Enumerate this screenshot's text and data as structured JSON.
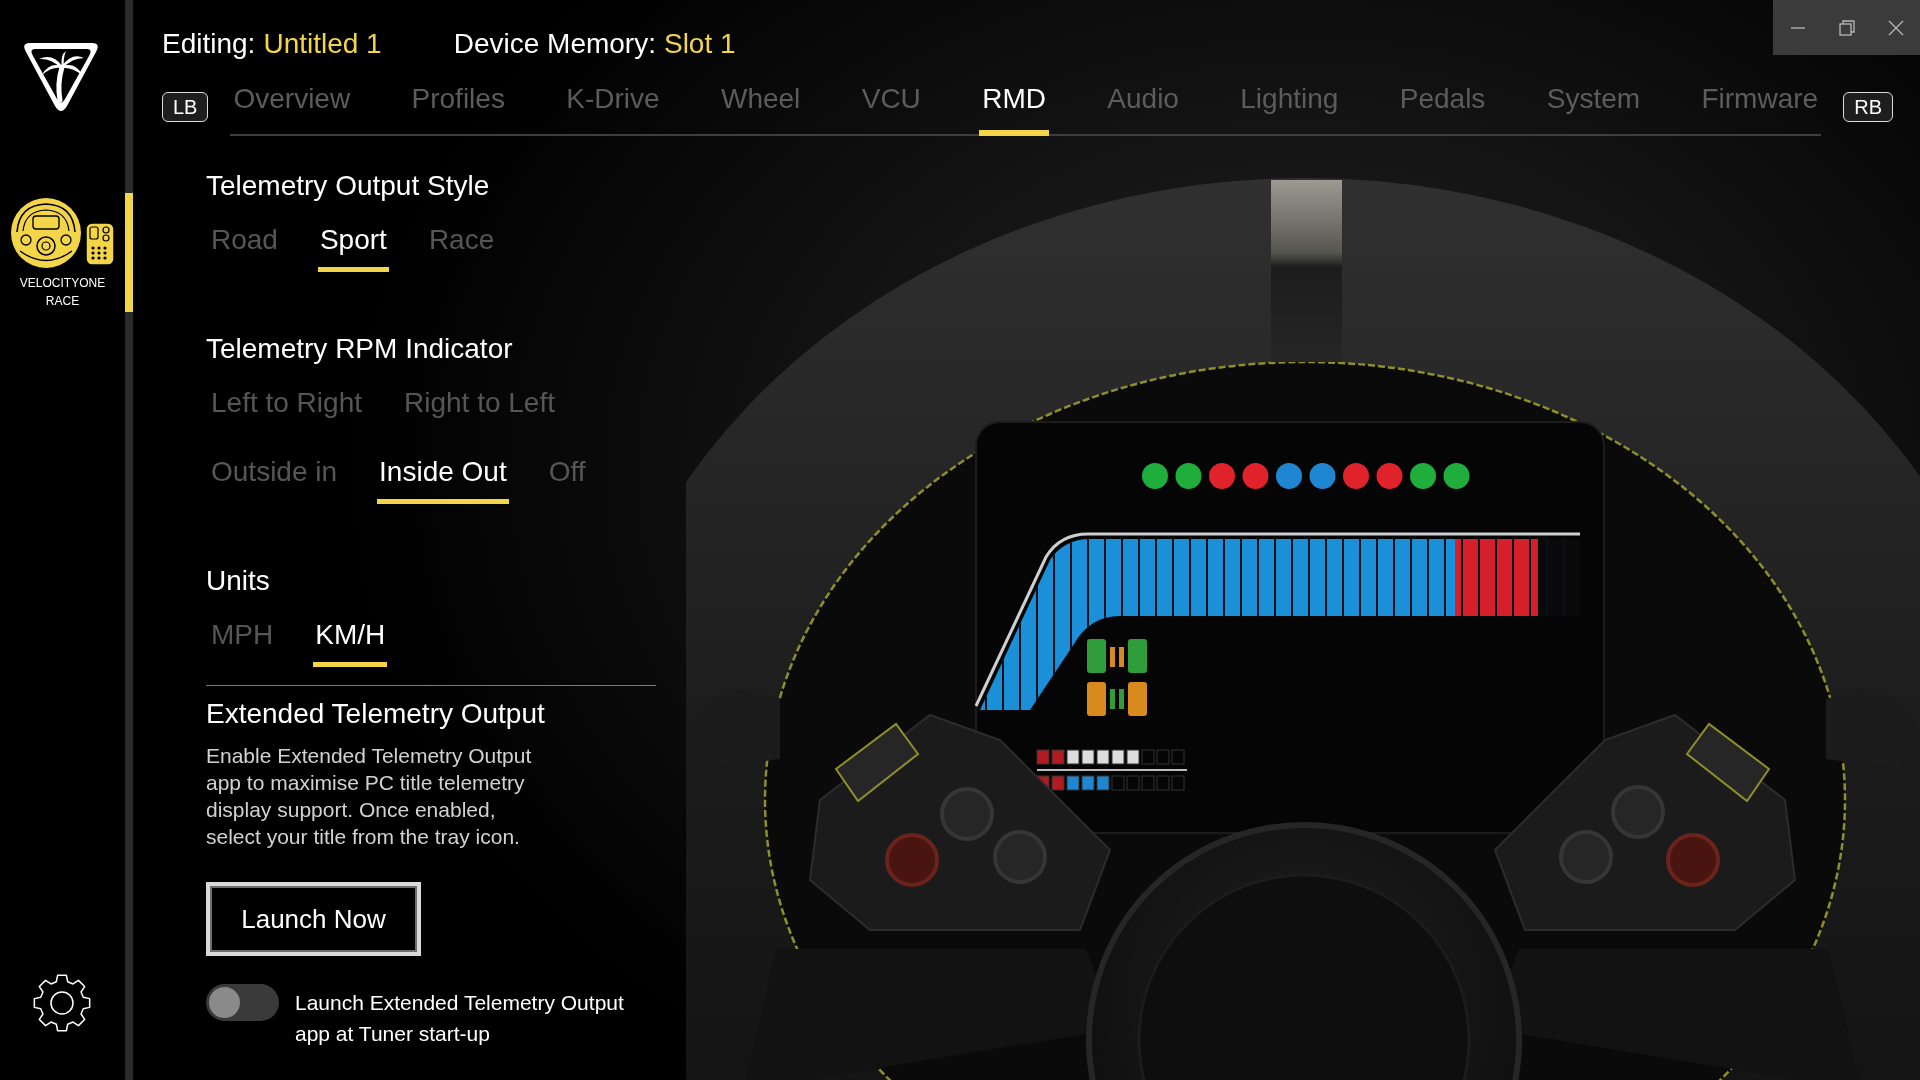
{
  "sidebar": {
    "devices": [
      {
        "name": "VELOCITYONE RACE",
        "selected": true
      }
    ]
  },
  "header": {
    "editing": {
      "label": "Editing:",
      "value": "Untitled 1"
    },
    "memory": {
      "label": "Device Memory:",
      "value": "Slot 1"
    }
  },
  "tabs": {
    "prev_button": "LB",
    "items": [
      {
        "label": "Overview",
        "selected": false
      },
      {
        "label": "Profiles",
        "selected": false
      },
      {
        "label": "K-Drive",
        "selected": false
      },
      {
        "label": "Wheel",
        "selected": false
      },
      {
        "label": "VCU",
        "selected": false
      },
      {
        "label": "RMD",
        "selected": true
      },
      {
        "label": "Audio",
        "selected": false
      },
      {
        "label": "Lighting",
        "selected": false
      },
      {
        "label": "Pedals",
        "selected": false
      },
      {
        "label": "System",
        "selected": false
      },
      {
        "label": "Firmware",
        "selected": false
      }
    ],
    "next_button": "RB"
  },
  "sections": [
    {
      "kind": "options",
      "title": "Telemetry Output Style",
      "rows": [
        {
          "options": [
            {
              "label": "Road",
              "selected": false
            },
            {
              "label": "Sport",
              "selected": true
            },
            {
              "label": "Race",
              "selected": false
            }
          ]
        }
      ]
    },
    {
      "kind": "options",
      "title": "Telemetry RPM Indicator",
      "rows": [
        {
          "options": [
            {
              "label": "Left to Right",
              "selected": false
            },
            {
              "label": "Right to Left",
              "selected": false
            }
          ]
        },
        {
          "options": [
            {
              "label": "Outside in",
              "selected": false
            },
            {
              "label": "Inside Out",
              "selected": true
            },
            {
              "label": "Off",
              "selected": false
            }
          ]
        }
      ]
    },
    {
      "kind": "options",
      "title": "Units",
      "rows": [
        {
          "options": [
            {
              "label": "MPH",
              "selected": false
            },
            {
              "label": "KM/H",
              "selected": true
            }
          ]
        }
      ]
    },
    {
      "kind": "extended",
      "title": "Extended Telemetry Output",
      "description": "Enable Extended Telemetry Output app to maximise PC title telemetry display support. Once enabled, select your title from the tray icon.",
      "button": "Launch Now",
      "toggle": {
        "label": "Launch Extended Telemetry Output app at Tuner start-up",
        "on": false
      }
    }
  ]
}
